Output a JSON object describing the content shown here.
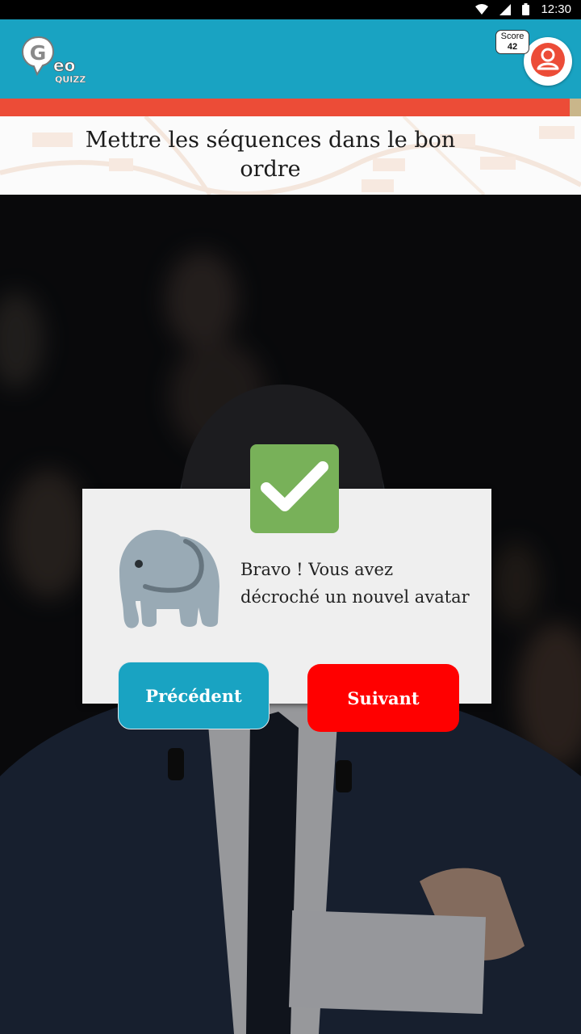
{
  "status_bar": {
    "time": "12:30"
  },
  "app_bar": {
    "logo": {
      "letter": "G",
      "suffix": "eo",
      "sub": "QUIZZ"
    },
    "score": {
      "label": "Score",
      "value": "42"
    }
  },
  "progress": {
    "percent": 98
  },
  "question": {
    "text": "Mettre les séquences dans le bon ordre"
  },
  "dialog": {
    "message": "Bravo ! Vous avez décroché un nouvel avatar",
    "previous_label": "Précédent",
    "next_label": "Suivant"
  },
  "colors": {
    "primary": "#19a3c2",
    "progress": "#ec4c37",
    "success": "#78b159",
    "next_button": "#ff0000"
  },
  "icons": {
    "status": [
      "wifi-icon",
      "signal-icon",
      "battery-icon"
    ],
    "avatar": "user-icon",
    "success": "checkmark-icon",
    "reward": "elephant-icon"
  }
}
